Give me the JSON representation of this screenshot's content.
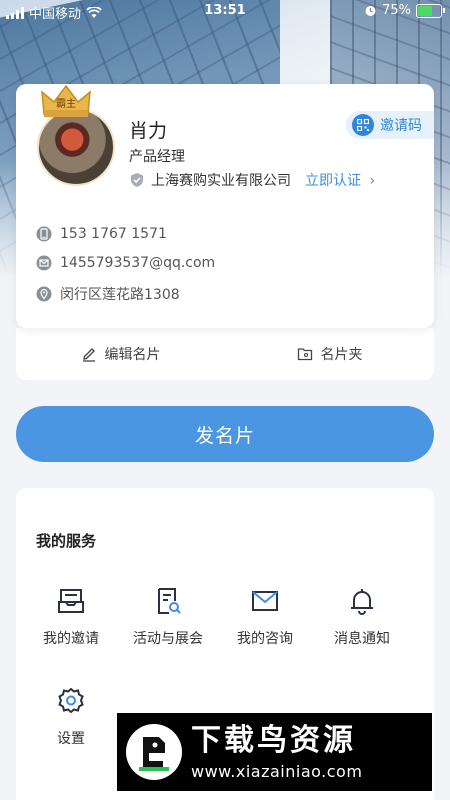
{
  "status_bar": {
    "carrier": "中国移动",
    "time": "13:51",
    "battery_percent": "75%",
    "battery_level": 0.75
  },
  "profile": {
    "name": "肖力",
    "title": "产品经理",
    "company": "上海赛购实业有限公司",
    "certify_label": "立即认证",
    "invite_code_label": "邀请码",
    "crown_label": "霸主",
    "phone": "153 1767 1571",
    "email": "1455793537@qq.com",
    "address": "闵行区莲花路1308"
  },
  "actions": {
    "edit_label": "编辑名片",
    "folder_label": "名片夹"
  },
  "send_button_label": "发名片",
  "services": {
    "title": "我的服务",
    "items": [
      {
        "label": "我的邀请",
        "icon": "inbox-icon"
      },
      {
        "label": "活动与展会",
        "icon": "document-search-icon"
      },
      {
        "label": "我的咨询",
        "icon": "mail-icon"
      },
      {
        "label": "消息通知",
        "icon": "bell-icon"
      },
      {
        "label": "设置",
        "icon": "gear-icon"
      }
    ]
  },
  "watermark": {
    "title": "下载鸟资源",
    "url": "www.xiazainiao.com"
  },
  "colors": {
    "accent": "#4a96e2",
    "link": "#3d8ee0",
    "invite_bg": "#e6f1fb"
  }
}
